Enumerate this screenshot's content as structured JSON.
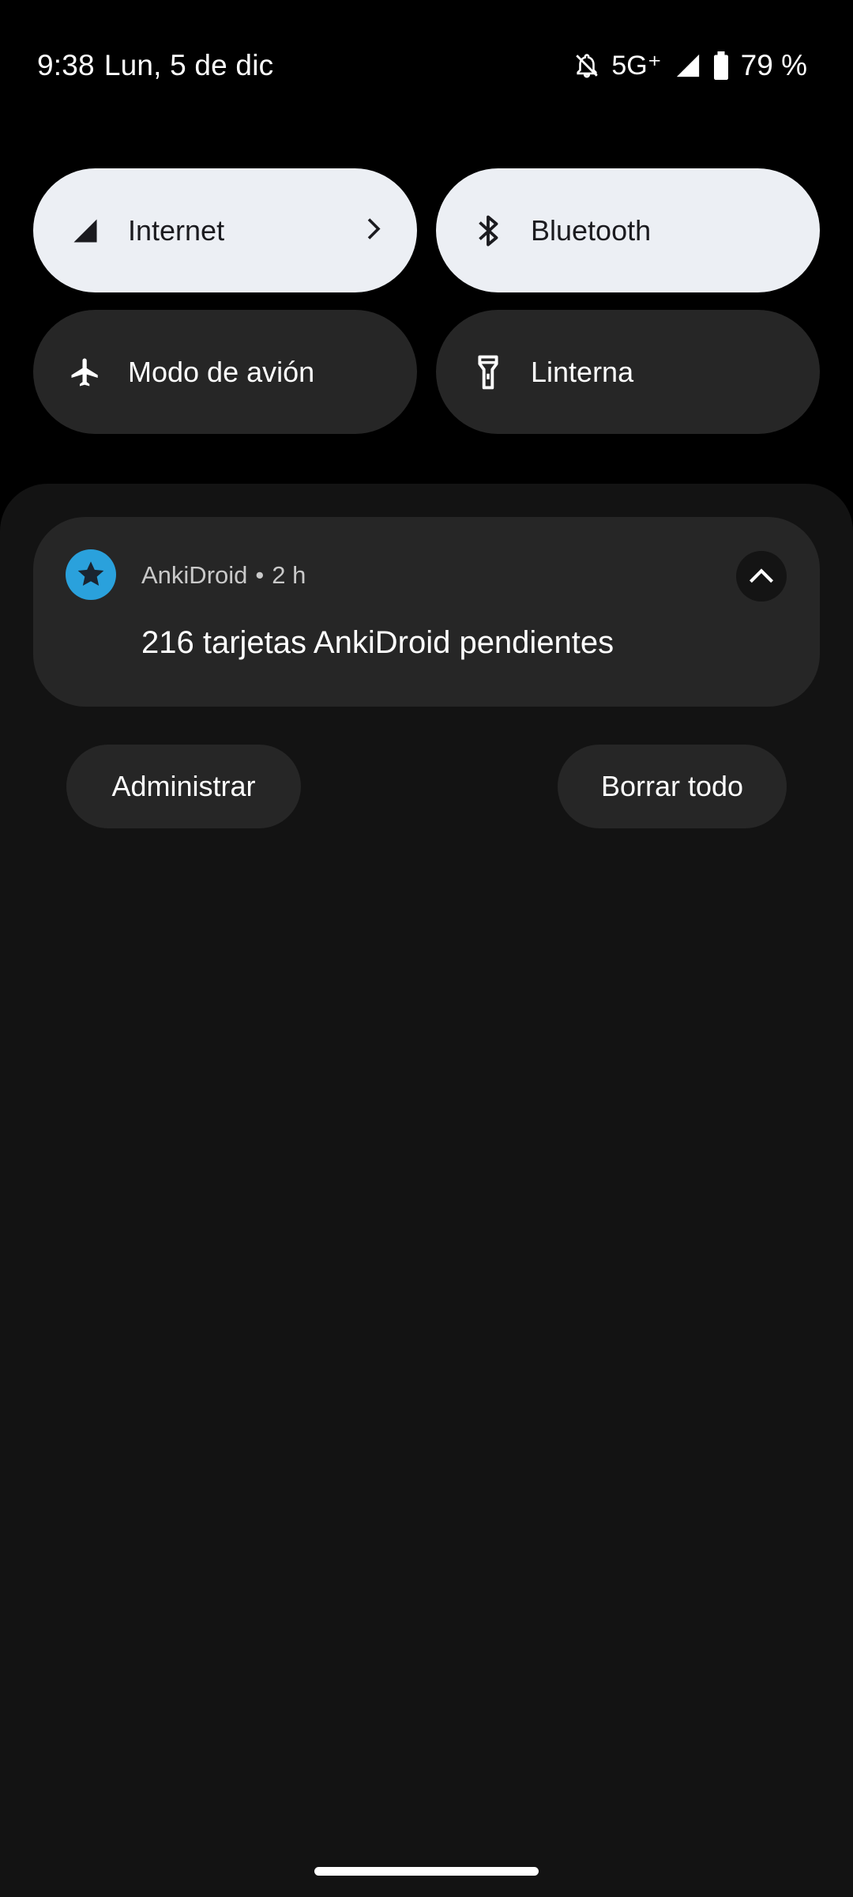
{
  "status_bar": {
    "time": "9:38",
    "date": "Lun, 5 de dic",
    "network": "5G⁺",
    "battery": "79 %",
    "icons": [
      "notifications-off-icon",
      "signal-icon",
      "battery-icon"
    ]
  },
  "quick_settings": {
    "tiles": [
      {
        "label": "Internet",
        "state": "active",
        "icon": "cell-signal-icon",
        "has_chevron": true
      },
      {
        "label": "Bluetooth",
        "state": "active",
        "icon": "bluetooth-icon"
      },
      {
        "label": "Modo de avión",
        "state": "inactive",
        "icon": "airplane-icon"
      },
      {
        "label": "Linterna",
        "state": "inactive",
        "icon": "flashlight-icon"
      }
    ]
  },
  "notification": {
    "app_name": "AnkiDroid",
    "separator": "•",
    "time_ago": "2 h",
    "title": "216 tarjetas AnkiDroid pendientes",
    "app_icon_color": "#2aa1dc"
  },
  "actions": {
    "manage_label": "Administrar",
    "clear_all_label": "Borrar todo"
  },
  "colors": {
    "background": "#000000",
    "shade": "#131313",
    "tile_active": "#eceff4",
    "tile_inactive": "#262626"
  }
}
